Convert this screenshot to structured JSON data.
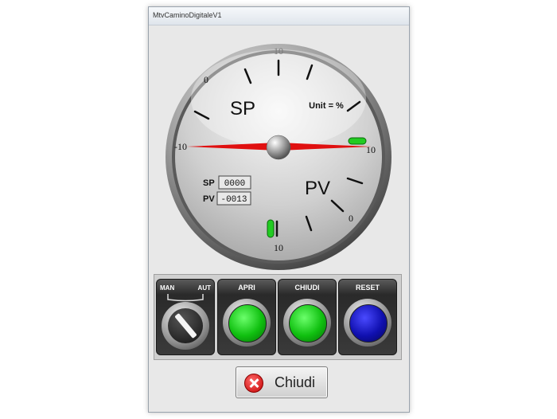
{
  "window": {
    "title": "MtvCaminoDigitaleV1"
  },
  "gauge": {
    "sp_label": "SP",
    "pv_label": "PV",
    "unit": "Unit = %",
    "scale_top": "10",
    "scale_top_left": "0",
    "scale_left": "-10",
    "scale_right": "10",
    "scale_bottom": "10",
    "scale_bottom_right": "0",
    "sp_field_label": "SP",
    "sp_value": "0000",
    "pv_field_label": "PV",
    "pv_value": "-0013",
    "needle_color": "#e01010",
    "indicator_color": "#22cc22"
  },
  "controls": {
    "mode_man": "MAN",
    "mode_aut": "AUT",
    "apri": "APRI",
    "chiudi": "CHIUDI",
    "reset": "RESET",
    "apri_color": "#10c010",
    "chiudi_color": "#10c010",
    "reset_color": "#1010b0"
  },
  "footer": {
    "close_label": "Chiudi"
  }
}
